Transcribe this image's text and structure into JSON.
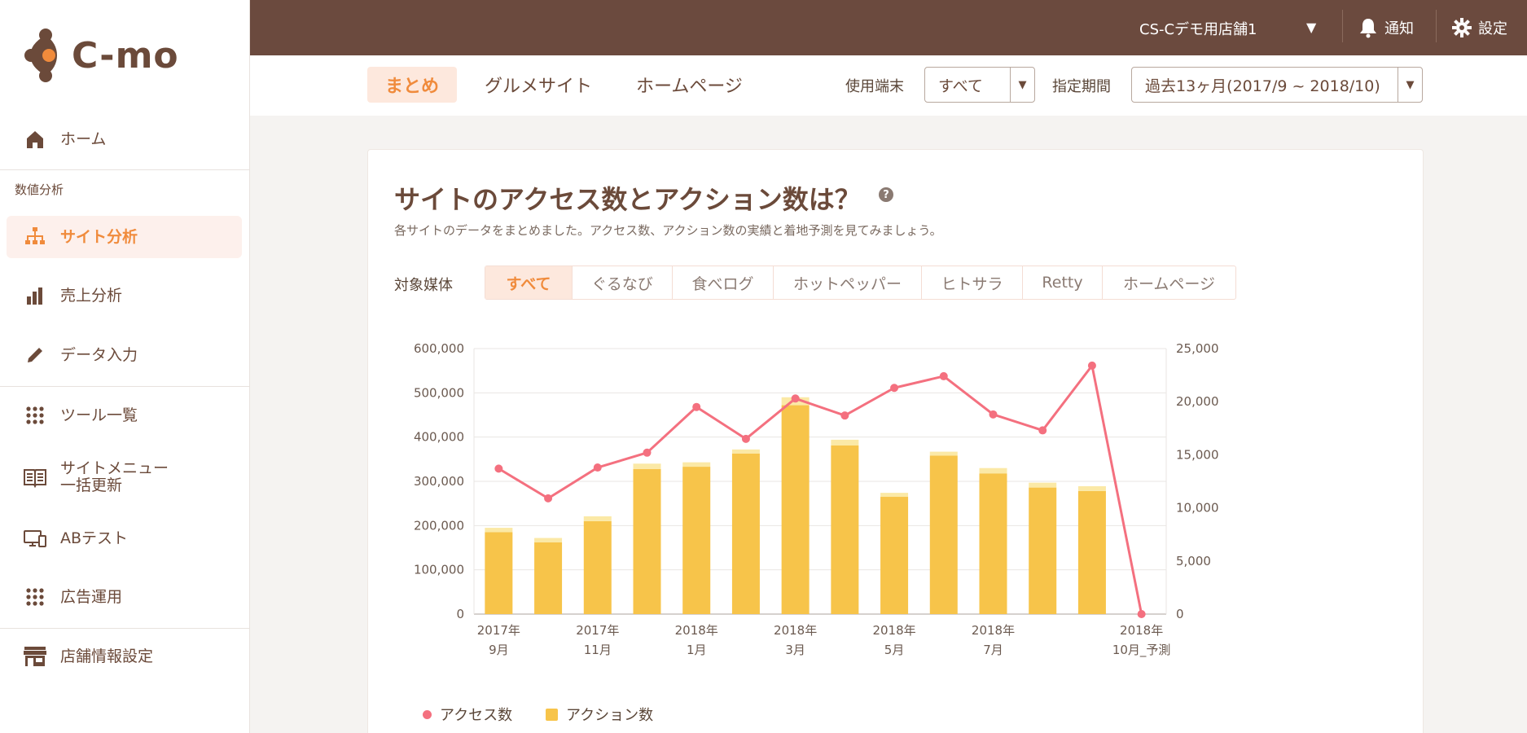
{
  "logo": {
    "text": "C-mo"
  },
  "sidebar": {
    "home": "ホーム",
    "section_analysis": "数値分析",
    "site_analysis": "サイト分析",
    "sales_analysis": "売上分析",
    "data_input": "データ入力",
    "tools": "ツール一覧",
    "site_menu_line1": "サイトメニュー",
    "site_menu_line2": "一括更新",
    "ab_test": "ABテスト",
    "ads": "広告運用",
    "store_settings": "店舗情報設定"
  },
  "header": {
    "store": "CS-Cデモ用店舗1",
    "notifications": "通知",
    "settings": "設定"
  },
  "subnav": {
    "tabs": [
      "まとめ",
      "グルメサイト",
      "ホームページ"
    ],
    "device_label": "使用端末",
    "device_value": "すべて",
    "period_label": "指定期間",
    "period_value": "過去13ヶ月(2017/9 ~ 2018/10)"
  },
  "card": {
    "title": "サイトのアクセス数とアクション数は？",
    "help": "?",
    "subtitle": "各サイトのデータをまとめました。アクセス数、アクション数の実績と着地予測を見てみましょう。",
    "media_label": "対象媒体",
    "media_options": [
      "すべて",
      "ぐるなび",
      "食べログ",
      "ホットペッパー",
      "ヒトサラ",
      "Retty",
      "ホームページ"
    ]
  },
  "colors": {
    "accent": "#f08b3c",
    "brown": "#6b4a3e",
    "bar": "#f7c44a",
    "bar_top": "#fbe9a6",
    "line": "#f4707f"
  },
  "chart_data": {
    "type": "bar",
    "categories": [
      "2017年 9月",
      "2017年 10月",
      "2017年 11月",
      "2017年 12月",
      "2018年 1月",
      "2018年 2月",
      "2018年 3月",
      "2018年 4月",
      "2018年 5月",
      "2018年 6月",
      "2018年 7月",
      "2018年 8月",
      "2018年 9月",
      "2018年 10月_予測"
    ],
    "x_tick_labels": [
      {
        "index": 0,
        "line1": "2017年",
        "line2": "9月"
      },
      {
        "index": 2,
        "line1": "2017年",
        "line2": "11月"
      },
      {
        "index": 4,
        "line1": "2018年",
        "line2": "1月"
      },
      {
        "index": 6,
        "line1": "2018年",
        "line2": "3月"
      },
      {
        "index": 8,
        "line1": "2018年",
        "line2": "5月"
      },
      {
        "index": 10,
        "line1": "2018年",
        "line2": "7月"
      },
      {
        "index": 13,
        "line1": "2018年",
        "line2": "10月_予測"
      }
    ],
    "series": [
      {
        "name": "アクション数",
        "type": "bar",
        "axis": "left",
        "values": [
          185000,
          162000,
          210000,
          328000,
          333000,
          363000,
          472000,
          381000,
          265000,
          358000,
          318000,
          286000,
          278000,
          0
        ],
        "top_values": [
          10000,
          10000,
          11000,
          12000,
          10000,
          9000,
          18000,
          13000,
          9000,
          9000,
          12000,
          11000,
          11000,
          0
        ]
      },
      {
        "name": "アクセス数",
        "type": "line",
        "axis": "right",
        "values": [
          13700,
          10900,
          13800,
          15200,
          19500,
          16500,
          20300,
          18700,
          21300,
          22400,
          18800,
          17300,
          23400,
          0
        ]
      }
    ],
    "y_left": {
      "ticks": [
        "0",
        "100,000",
        "200,000",
        "300,000",
        "400,000",
        "500,000",
        "600,000"
      ],
      "min": 0,
      "max": 600000
    },
    "y_right": {
      "ticks": [
        "0",
        "5,000",
        "10,000",
        "15,000",
        "20,000",
        "25,000"
      ],
      "min": 0,
      "max": 25000
    },
    "legend": [
      "アクセス数",
      "アクション数"
    ],
    "grid": true
  }
}
